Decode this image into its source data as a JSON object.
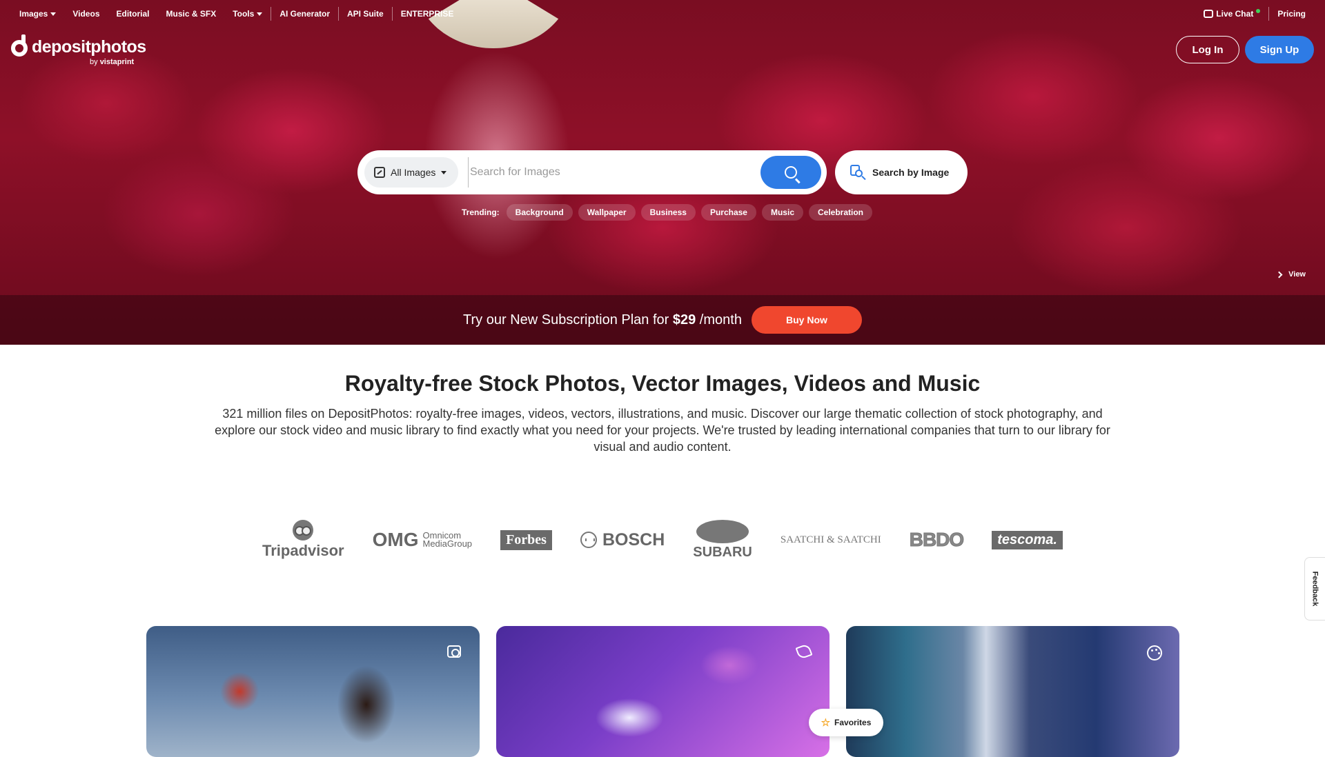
{
  "topnav": {
    "items": [
      {
        "label": "Images",
        "has_caret": true
      },
      {
        "label": "Videos"
      },
      {
        "label": "Editorial"
      },
      {
        "label": "Music & SFX"
      },
      {
        "label": "Tools",
        "has_caret": true
      },
      {
        "label": "AI Generator"
      },
      {
        "label": "API Suite"
      },
      {
        "label": "ENTERPRISE"
      }
    ],
    "live_chat": "Live Chat",
    "pricing": "Pricing"
  },
  "logo": {
    "word": "depositphotos",
    "by": "by",
    "brand": "vistaprint"
  },
  "auth": {
    "login": "Log In",
    "signup": "Sign Up"
  },
  "search": {
    "type": "All Images",
    "placeholder": "Search for Images",
    "search_by_image": "Search by Image"
  },
  "trending": {
    "label": "Trending:",
    "chips": [
      "Background",
      "Wallpaper",
      "Business",
      "Purchase",
      "Music",
      "Celebration"
    ]
  },
  "hero": {
    "view_label": "View"
  },
  "promo": {
    "text_before": "Try our New Subscription Plan for ",
    "price": "$29",
    "text_after": " /month",
    "button": "Buy Now"
  },
  "main": {
    "headline": "Royalty-free Stock Photos, Vector Images, Videos and Music",
    "description": "321 million files on DepositPhotos: royalty-free images, videos, vectors, illustrations, and music. Discover our large thematic collection of stock photography, and explore our stock video and music library to find exactly what you need for your projects. We're trusted by leading international companies that turn to our library for visual and audio content."
  },
  "brands": {
    "tripadvisor": "Tripadvisor",
    "omg": "OMG",
    "omnicom_1": "Omnicom",
    "omnicom_2": "MediaGroup",
    "forbes": "Forbes",
    "bosch": "BOSCH",
    "subaru": "SUBARU",
    "saatchi": "SAATCHI & SAATCHI",
    "bbdo": "BBDO",
    "tescoma": "tescoma."
  },
  "cards": [
    {
      "icon": "camera-icon"
    },
    {
      "icon": "pen-icon"
    },
    {
      "icon": "palette-icon"
    }
  ],
  "favorites": "Favorites",
  "feedback": "Feedback",
  "colors": {
    "accent": "#2e7be5",
    "buy_now": "#f0472e",
    "hero_red": "#b8183c"
  }
}
